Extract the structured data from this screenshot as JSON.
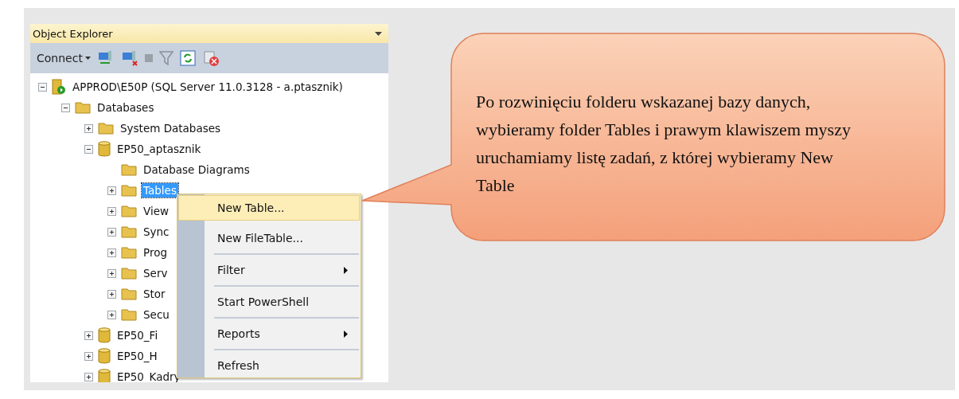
{
  "panel": {
    "title": "Object Explorer",
    "toolbar": {
      "connect": "Connect"
    }
  },
  "tree": [
    {
      "kind": "server",
      "label": "APPROD\\E50P (SQL Server 11.0.3128 - a.ptasznik)",
      "expanded": true,
      "selected": false,
      "children": [
        {
          "kind": "folder",
          "label": "Databases",
          "expanded": true,
          "selected": false,
          "children": [
            {
              "kind": "folder",
              "label": "System Databases",
              "expanded": false,
              "selected": false
            },
            {
              "kind": "database",
              "label": "EP50_aptasznik",
              "expanded": true,
              "selected": false,
              "children": [
                {
                  "kind": "folder",
                  "label": "Database Diagrams",
                  "selected": false
                },
                {
                  "kind": "folder",
                  "label": "Tables",
                  "expanded": false,
                  "selected": true
                },
                {
                  "kind": "folder",
                  "label": "View",
                  "expanded": false,
                  "selected": false
                },
                {
                  "kind": "folder",
                  "label": "Sync",
                  "expanded": false,
                  "selected": false
                },
                {
                  "kind": "folder",
                  "label": "Prog",
                  "expanded": false,
                  "selected": false
                },
                {
                  "kind": "folder",
                  "label": "Serv",
                  "expanded": false,
                  "selected": false
                },
                {
                  "kind": "folder",
                  "label": "Stor",
                  "expanded": false,
                  "selected": false
                },
                {
                  "kind": "folder",
                  "label": "Secu",
                  "expanded": false,
                  "selected": false
                }
              ]
            },
            {
              "kind": "database",
              "label": "EP50_Fi",
              "expanded": false,
              "selected": false
            },
            {
              "kind": "database",
              "label": "EP50_H",
              "expanded": false,
              "selected": false
            },
            {
              "kind": "database",
              "label": "EP50_Kadry",
              "expanded": false,
              "selected": false
            }
          ]
        }
      ]
    }
  ],
  "context_menu": {
    "groups": [
      [
        {
          "label": "New Table...",
          "selected": true,
          "submenu": false
        },
        {
          "label": "New FileTable...",
          "selected": false,
          "submenu": false
        }
      ],
      [
        {
          "label": "Filter",
          "selected": false,
          "submenu": true
        }
      ],
      [
        {
          "label": "Start PowerShell",
          "selected": false,
          "submenu": false
        }
      ],
      [
        {
          "label": "Reports",
          "selected": false,
          "submenu": true
        }
      ],
      [
        {
          "label": "Refresh",
          "selected": false,
          "submenu": false
        }
      ]
    ]
  },
  "callout": {
    "text": "Po rozwinięciu folderu wskazanej bazy danych, wybieramy folder Tables i prawym klawiszem myszy uruchamiamy listę zadań, z której wybieramy New Table"
  }
}
